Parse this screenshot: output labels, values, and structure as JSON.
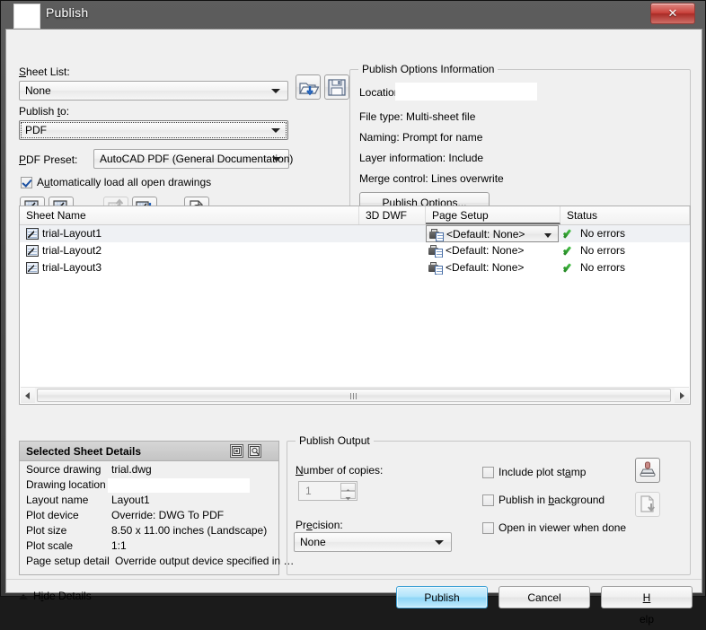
{
  "window": {
    "title": "Publish",
    "close_label": "✕",
    "icon": "app-icon"
  },
  "left_panel": {
    "sheet_list_label": "Sheet List:",
    "sheet_list_value": "None",
    "load_list_icon": "open-folder-icon",
    "save_list_icon": "floppy-disk-icon",
    "publish_to_label": "Publish to:",
    "publish_to_value": "PDF",
    "pdf_preset_label": "PDF Preset:",
    "pdf_preset_value": "AutoCAD PDF (General Documentation)",
    "auto_load_label": "Automatically load all open drawings",
    "auto_load_checked": true,
    "toolbar": [
      {
        "name": "add-sheets-icon",
        "enabled": true
      },
      {
        "name": "remove-sheets-icon",
        "enabled": true
      },
      {
        "name": "move-sheet-up-icon",
        "enabled": false
      },
      {
        "name": "move-sheet-down-icon",
        "enabled": true
      },
      {
        "name": "preview-icon",
        "enabled": true
      }
    ]
  },
  "options_info": {
    "title": "Publish Options Information",
    "location_label": "Location:",
    "location_value": "",
    "file_type": "File type: Multi-sheet file",
    "naming": "Naming: Prompt for name",
    "layer_information": "Layer information: Include",
    "merge_control": "Merge control: Lines overwrite",
    "publish_options_button": "Publish Options..."
  },
  "sheet_table": {
    "columns": [
      "Sheet Name",
      "3D DWF",
      "Page Setup",
      "Status"
    ],
    "rows": [
      {
        "sheet_name": "trial-Layout1",
        "dwf": "",
        "page_setup": "<Default: None>",
        "status": "No errors",
        "selected": true
      },
      {
        "sheet_name": "trial-Layout2",
        "dwf": "",
        "page_setup": "<Default: None>",
        "status": "No errors",
        "selected": false
      },
      {
        "sheet_name": "trial-Layout3",
        "dwf": "",
        "page_setup": "<Default: None>",
        "status": "No errors",
        "selected": false
      }
    ]
  },
  "details": {
    "title": "Selected Sheet Details",
    "header_icons": [
      "details-list-icon",
      "details-preview-icon"
    ],
    "rows": [
      {
        "key": "Source drawing",
        "value": "trial.dwg"
      },
      {
        "key": "Drawing location",
        "value": ""
      },
      {
        "key": "Layout name",
        "value": "Layout1"
      },
      {
        "key": "Plot device",
        "value": "Override: DWG To PDF"
      },
      {
        "key": "Plot size",
        "value": "8.50 x 11.00 inches (Landscape)"
      },
      {
        "key": "Plot scale",
        "value": "1:1"
      },
      {
        "key": "Page setup detail",
        "value": "Override output device specified in …"
      }
    ]
  },
  "publish_output": {
    "title": "Publish Output",
    "copies_label": "Number of copies:",
    "copies_value": "1",
    "copies_enabled": false,
    "precision_label": "Precision:",
    "precision_value": "None",
    "checkboxes": [
      {
        "label": "Include plot stamp",
        "checked": false
      },
      {
        "label": "Publish in background",
        "checked": false
      },
      {
        "label": "Open in viewer when done",
        "checked": false
      }
    ],
    "action_icons": [
      {
        "name": "plot-stamp-settings-icon",
        "enabled": true
      },
      {
        "name": "publish-background-icon",
        "enabled": false
      }
    ]
  },
  "footer": {
    "hide_details": "Hide Details",
    "publish": "Publish",
    "cancel": "Cancel",
    "help": "Help"
  },
  "colors": {
    "accent": "#8ed6f7",
    "status_ok": "#2f9e2f",
    "close": "#c9403a"
  }
}
